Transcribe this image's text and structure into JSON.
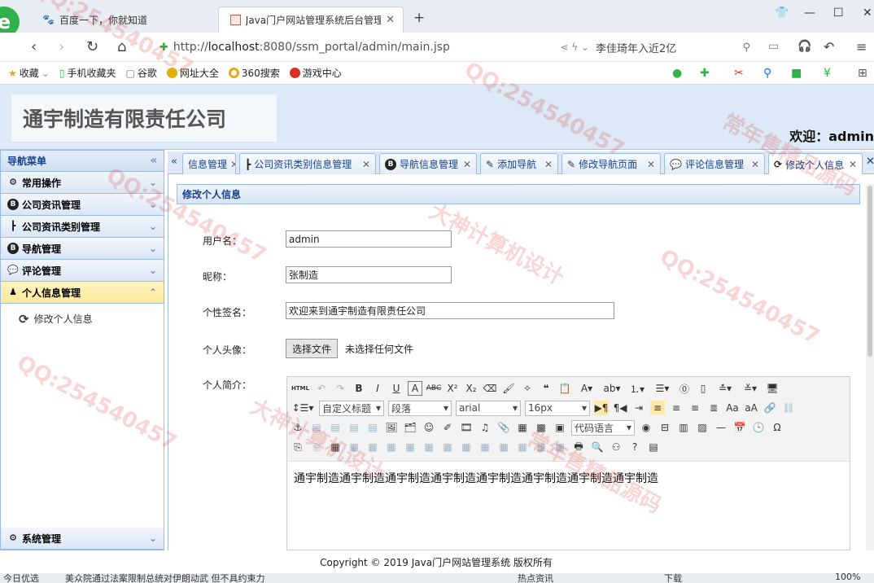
{
  "browser": {
    "tabs": [
      {
        "title": "百度一下，你就知道",
        "active": false
      },
      {
        "title": "Java门户网站管理系统后台管理",
        "active": true
      }
    ],
    "new_tab": "+",
    "url_scheme": "http://",
    "url_host": "localhost",
    "url_rest": ":8080/ssm_portal/admin/main.jsp",
    "news": "李佳琦年入近2亿",
    "bookmarks": [
      "收藏",
      "手机收藏夹",
      "谷歌",
      "网址大全",
      "360搜索",
      "游戏中心"
    ]
  },
  "header": {
    "company": "通宇制造有限责任公司",
    "welcome": "欢迎：admin"
  },
  "sidebar": {
    "title": "导航菜单",
    "items": [
      {
        "label": "常用操作",
        "icon": "gear-icon"
      },
      {
        "label": "公司资讯管理",
        "icon": "b-icon"
      },
      {
        "label": "公司资讯类别管理",
        "icon": "tree-icon"
      },
      {
        "label": "导航管理",
        "icon": "b-icon"
      },
      {
        "label": "评论管理",
        "icon": "comment-icon"
      },
      {
        "label": "个人信息管理",
        "icon": "user-icon"
      }
    ],
    "sub_item": "修改个人信息",
    "bottom_item": "系统管理"
  },
  "tabs": [
    {
      "label": "信息管理"
    },
    {
      "label": "公司资讯类别信息管理"
    },
    {
      "label": "导航信息管理"
    },
    {
      "label": "添加导航"
    },
    {
      "label": "修改导航页面"
    },
    {
      "label": "评论信息管理"
    },
    {
      "label": "修改个人信息",
      "active": true
    }
  ],
  "form": {
    "panel_title": "修改个人信息",
    "username_label": "用户名：",
    "username_value": "admin",
    "nickname_label": "昵称：",
    "nickname_value": "张制造",
    "signature_label": "个性签名：",
    "signature_value": "欢迎来到通宇制造有限责任公司",
    "avatar_label": "个人头像：",
    "file_button": "选择文件",
    "file_status": "未选择任何文件",
    "intro_label": "个人简介："
  },
  "editor": {
    "html_label": "HTML",
    "block_select": "自定义标题",
    "para_select": "段落",
    "font_select": "arial",
    "size_select": "16px",
    "code_select": "代码语言",
    "content": "通宇制造通宇制造通宇制造通宇制造通宇制造通宇制造通宇制造通宇制造"
  },
  "footer": {
    "copyright": "Copyright © 2019 Java门户网站管理系统 版权所有"
  },
  "statusbar": {
    "left": "今日优选",
    "news": "美众院通过法案限制总统对伊朗动武 但不具约束力",
    "hot": "热点资讯",
    "download": "下载",
    "zoom": "100%"
  },
  "watermarks": [
    "QQ:254540457",
    "常年售精品源码",
    "大神计算机设计"
  ]
}
